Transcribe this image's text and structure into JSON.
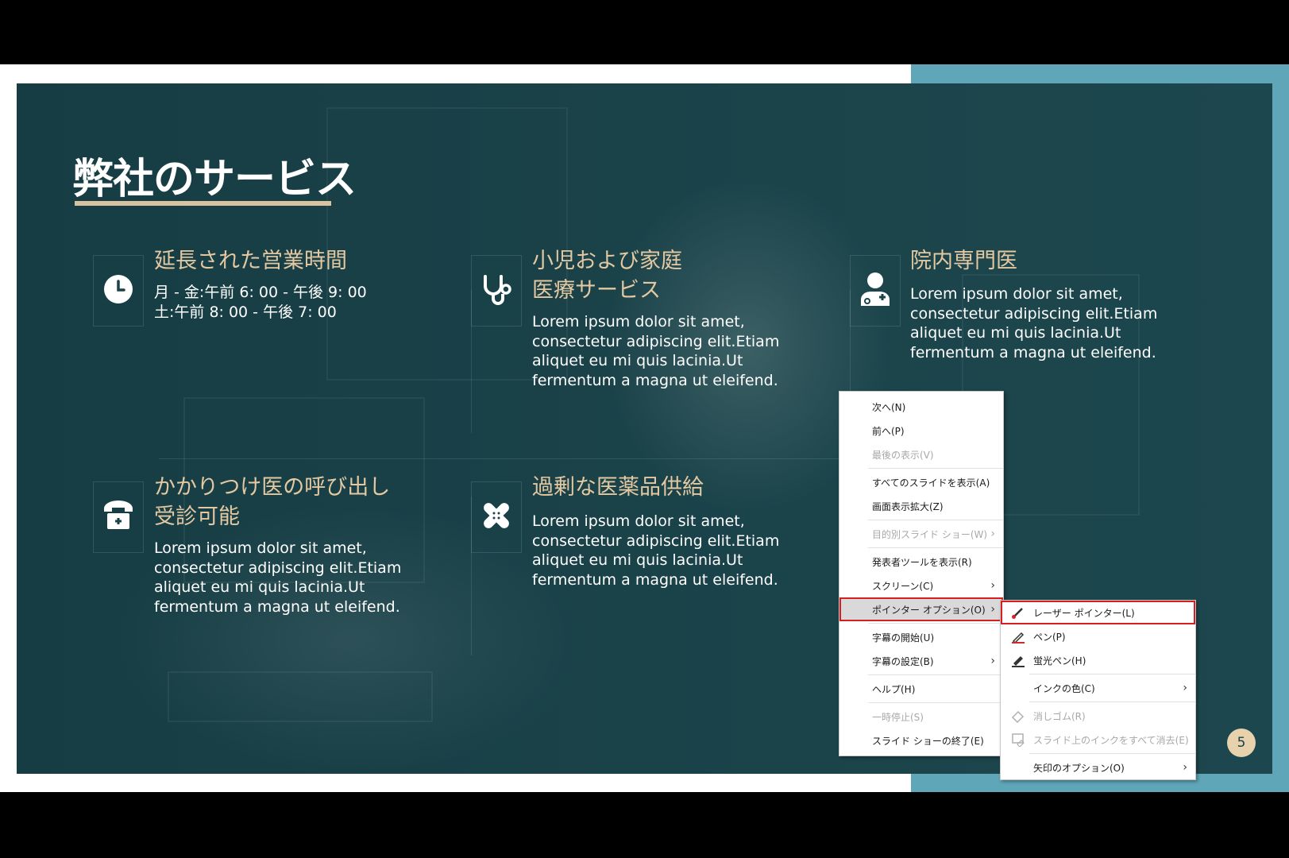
{
  "slide": {
    "title": "弊社のサービス",
    "page_number": "5",
    "colors": {
      "accent": "#e3c8a1",
      "background": "#1a4249",
      "frame_teal": "#5fa6b8"
    }
  },
  "services": [
    {
      "icon": "clock-icon",
      "heading": [
        "延長された営業時間"
      ],
      "body": [
        "月 - 金:午前 6: 00 - 午後 9: 00",
        "土:午前 8: 00 - 午後 7: 00"
      ]
    },
    {
      "icon": "stethoscope-icon",
      "heading": [
        "小児および家庭",
        "医療サービス"
      ],
      "body": [
        "Lorem ipsum dolor sit amet,",
        "consectetur adipiscing elit.Etiam",
        "aliquet eu mi quis lacinia.Ut",
        "fermentum a magna ut eleifend."
      ]
    },
    {
      "icon": "doctor-icon",
      "heading": [
        "院内専門医"
      ],
      "body": [
        "Lorem ipsum dolor sit amet,",
        "consectetur adipiscing elit.Etiam",
        "aliquet eu mi quis lacinia.Ut",
        "fermentum a magna ut eleifend."
      ]
    },
    {
      "icon": "telephone-icon",
      "heading": [
        "かかりつけ医の呼び出し",
        "受診可能"
      ],
      "body": [
        "Lorem ipsum dolor sit amet,",
        "consectetur adipiscing elit.Etiam",
        "aliquet eu mi quis lacinia.Ut",
        "fermentum a magna ut eleifend."
      ]
    },
    {
      "icon": "bandage-icon",
      "heading": [
        "過剰な医薬品供給"
      ],
      "body": [
        "Lorem ipsum dolor sit amet,",
        "consectetur adipiscing elit.Etiam",
        "aliquet eu mi quis lacinia.Ut",
        "fermentum a magna ut eleifend."
      ]
    }
  ],
  "context_menu": {
    "items": [
      {
        "label": "次へ(N)"
      },
      {
        "label": "前へ(P)"
      },
      {
        "label": "最後の表示(V)",
        "disabled": true
      },
      {
        "label": "すべてのスライドを表示(A)"
      },
      {
        "label": "画面表示拡大(Z)"
      },
      {
        "label": "目的別スライド ショー(W)",
        "disabled": true,
        "submenu": true
      },
      {
        "label": "発表者ツールを表示(R)"
      },
      {
        "label": "スクリーン(C)",
        "submenu": true
      },
      {
        "label": "ポインター オプション(O)",
        "submenu": true,
        "selected": true
      },
      {
        "label": "字幕の開始(U)"
      },
      {
        "label": "字幕の設定(B)",
        "submenu": true
      },
      {
        "label": "ヘルプ(H)"
      },
      {
        "label": "一時停止(S)",
        "disabled": true
      },
      {
        "label": "スライド ショーの終了(E)"
      }
    ]
  },
  "pointer_submenu": {
    "items": [
      {
        "label": "レーザー ポインター(L)",
        "icon": "laser-pointer-icon",
        "highlighted": true
      },
      {
        "label": "ペン(P)",
        "icon": "pen-icon"
      },
      {
        "label": "蛍光ペン(H)",
        "icon": "highlighter-icon"
      },
      {
        "label": "インクの色(C)",
        "submenu": true
      },
      {
        "label": "消しゴム(R)",
        "icon": "eraser-icon",
        "disabled": true
      },
      {
        "label": "スライド上のインクをすべて消去(E)",
        "icon": "erase-all-ink-icon",
        "disabled": true
      },
      {
        "label": "矢印のオプション(O)",
        "submenu": true
      }
    ]
  }
}
